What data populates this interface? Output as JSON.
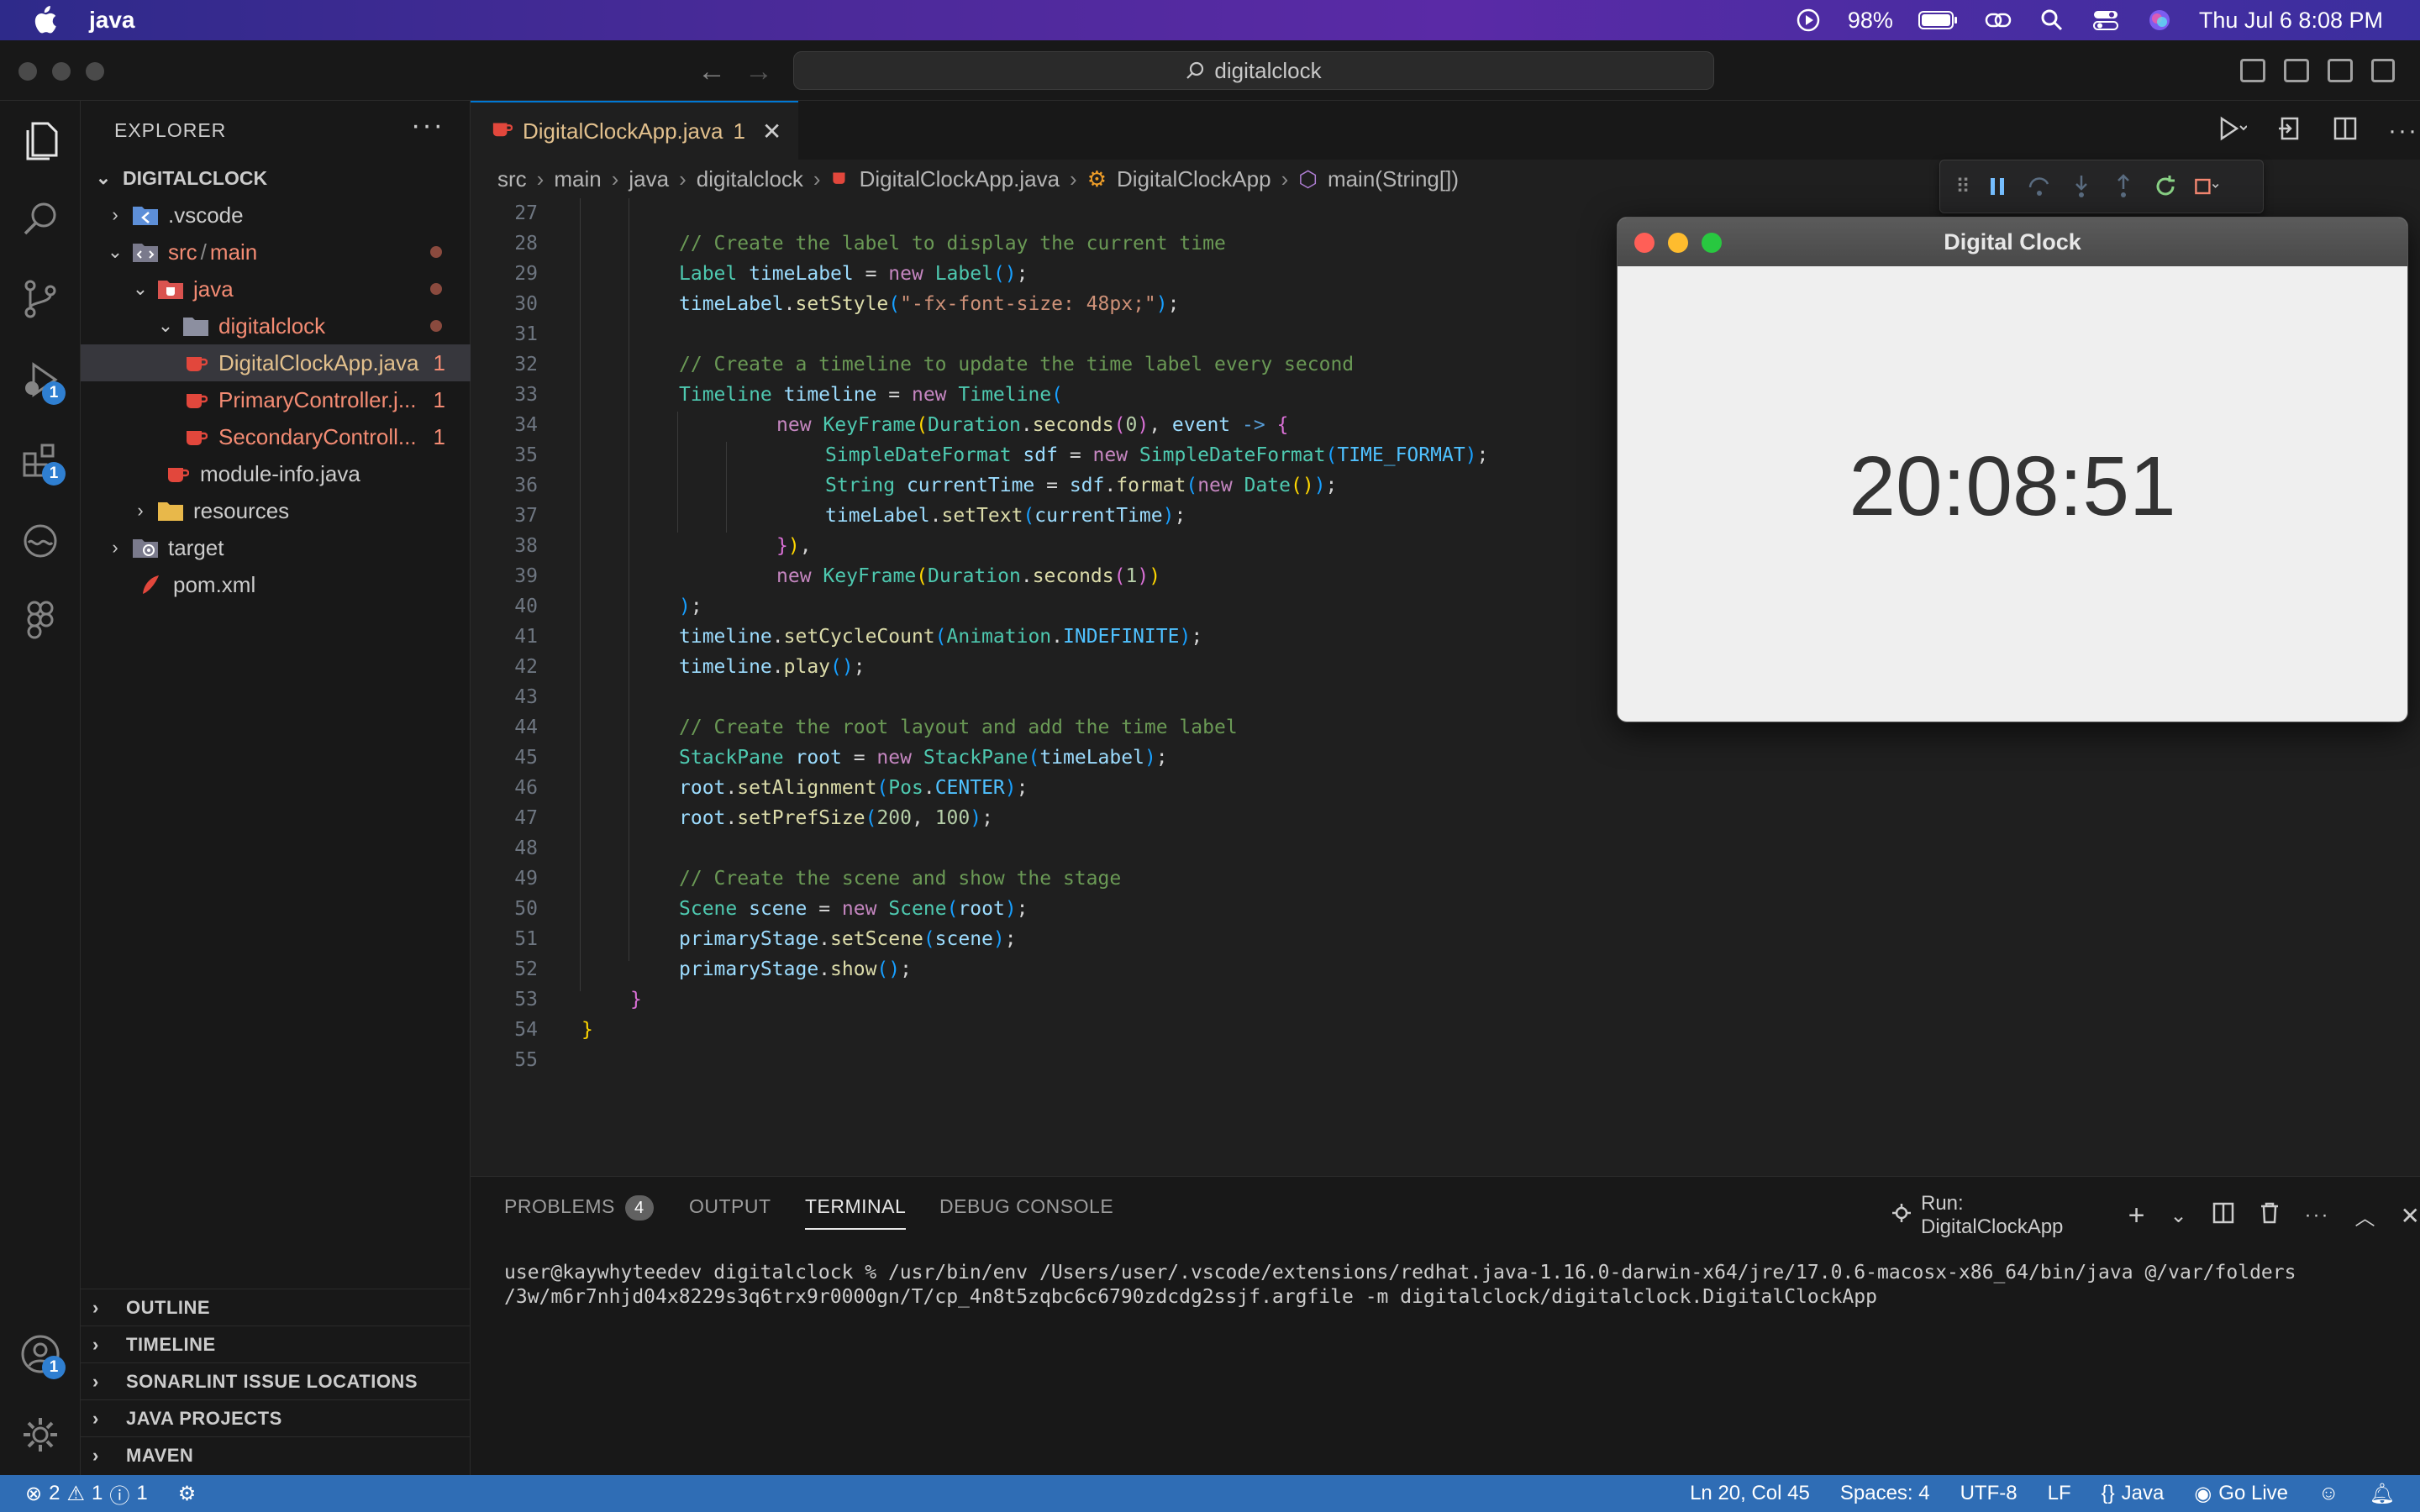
{
  "menubar": {
    "app_name": "java",
    "battery": "98%",
    "datetime": "Thu Jul 6  8:08 PM"
  },
  "titlebar": {
    "search_text": "digitalclock"
  },
  "activity": {
    "debug_badge": "1",
    "extensions_badge": "1",
    "accounts_badge": "1"
  },
  "sidebar": {
    "title": "EXPLORER",
    "more": "···",
    "root": "DIGITALCLOCK",
    "items": [
      {
        "label": ".vscode"
      },
      {
        "label_a": "src",
        "label_sep": "/",
        "label_b": "main"
      },
      {
        "label": "java"
      },
      {
        "label": "digitalclock"
      },
      {
        "label": "DigitalClockApp.java",
        "errors": "1"
      },
      {
        "label": "PrimaryController.j...",
        "errors": "1"
      },
      {
        "label": "SecondaryControll...",
        "errors": "1"
      },
      {
        "label": "module-info.java"
      },
      {
        "label": "resources"
      },
      {
        "label": "target"
      },
      {
        "label": "pom.xml"
      }
    ],
    "sections": [
      "OUTLINE",
      "TIMELINE",
      "SONARLINT ISSUE LOCATIONS",
      "JAVA PROJECTS",
      "MAVEN"
    ]
  },
  "editor": {
    "tab_label": "DigitalClockApp.java",
    "tab_errors": "1",
    "breadcrumb": [
      "src",
      "main",
      "java",
      "digitalclock",
      "DigitalClockApp.java",
      "DigitalClockApp",
      "main(String[])"
    ],
    "line_numbers": [
      "27",
      "28",
      "29",
      "30",
      "31",
      "32",
      "33",
      "34",
      "35",
      "36",
      "37",
      "38",
      "39",
      "40",
      "41",
      "42",
      "43",
      "44",
      "45",
      "46",
      "47",
      "48",
      "49",
      "50",
      "51",
      "52",
      "53",
      "54",
      "55"
    ]
  },
  "clock_window": {
    "title": "Digital Clock",
    "time": "20:08:51"
  },
  "panel": {
    "tabs": [
      "PROBLEMS",
      "OUTPUT",
      "TERMINAL",
      "DEBUG CONSOLE"
    ],
    "problems_count": "4",
    "run_label": "Run: DigitalClockApp",
    "terminal_line1": "user@kaywhyteedev digitalclock %  /usr/bin/env /Users/user/.vscode/extensions/redhat.java-1.16.0-darwin-x64/jre/17.0.6-macosx-x86_64/bin/java @/var/folders",
    "terminal_line2": "/3w/m6r7nhjd04x8229s3q6trx9r0000gn/T/cp_4n8t5zqbc6c6790zdcdg2ssjf.argfile -m digitalclock/digitalclock.DigitalClockApp"
  },
  "statusbar": {
    "errors": "2",
    "warnings": "1",
    "info": "1",
    "position": "Ln 20, Col 45",
    "spaces": "Spaces: 4",
    "encoding": "UTF-8",
    "eol": "LF",
    "language": "Java",
    "golive": "Go Live"
  },
  "colors": {
    "accent": "#0078d4",
    "statusbar": "#2f6db5",
    "error": "#f38b73"
  }
}
